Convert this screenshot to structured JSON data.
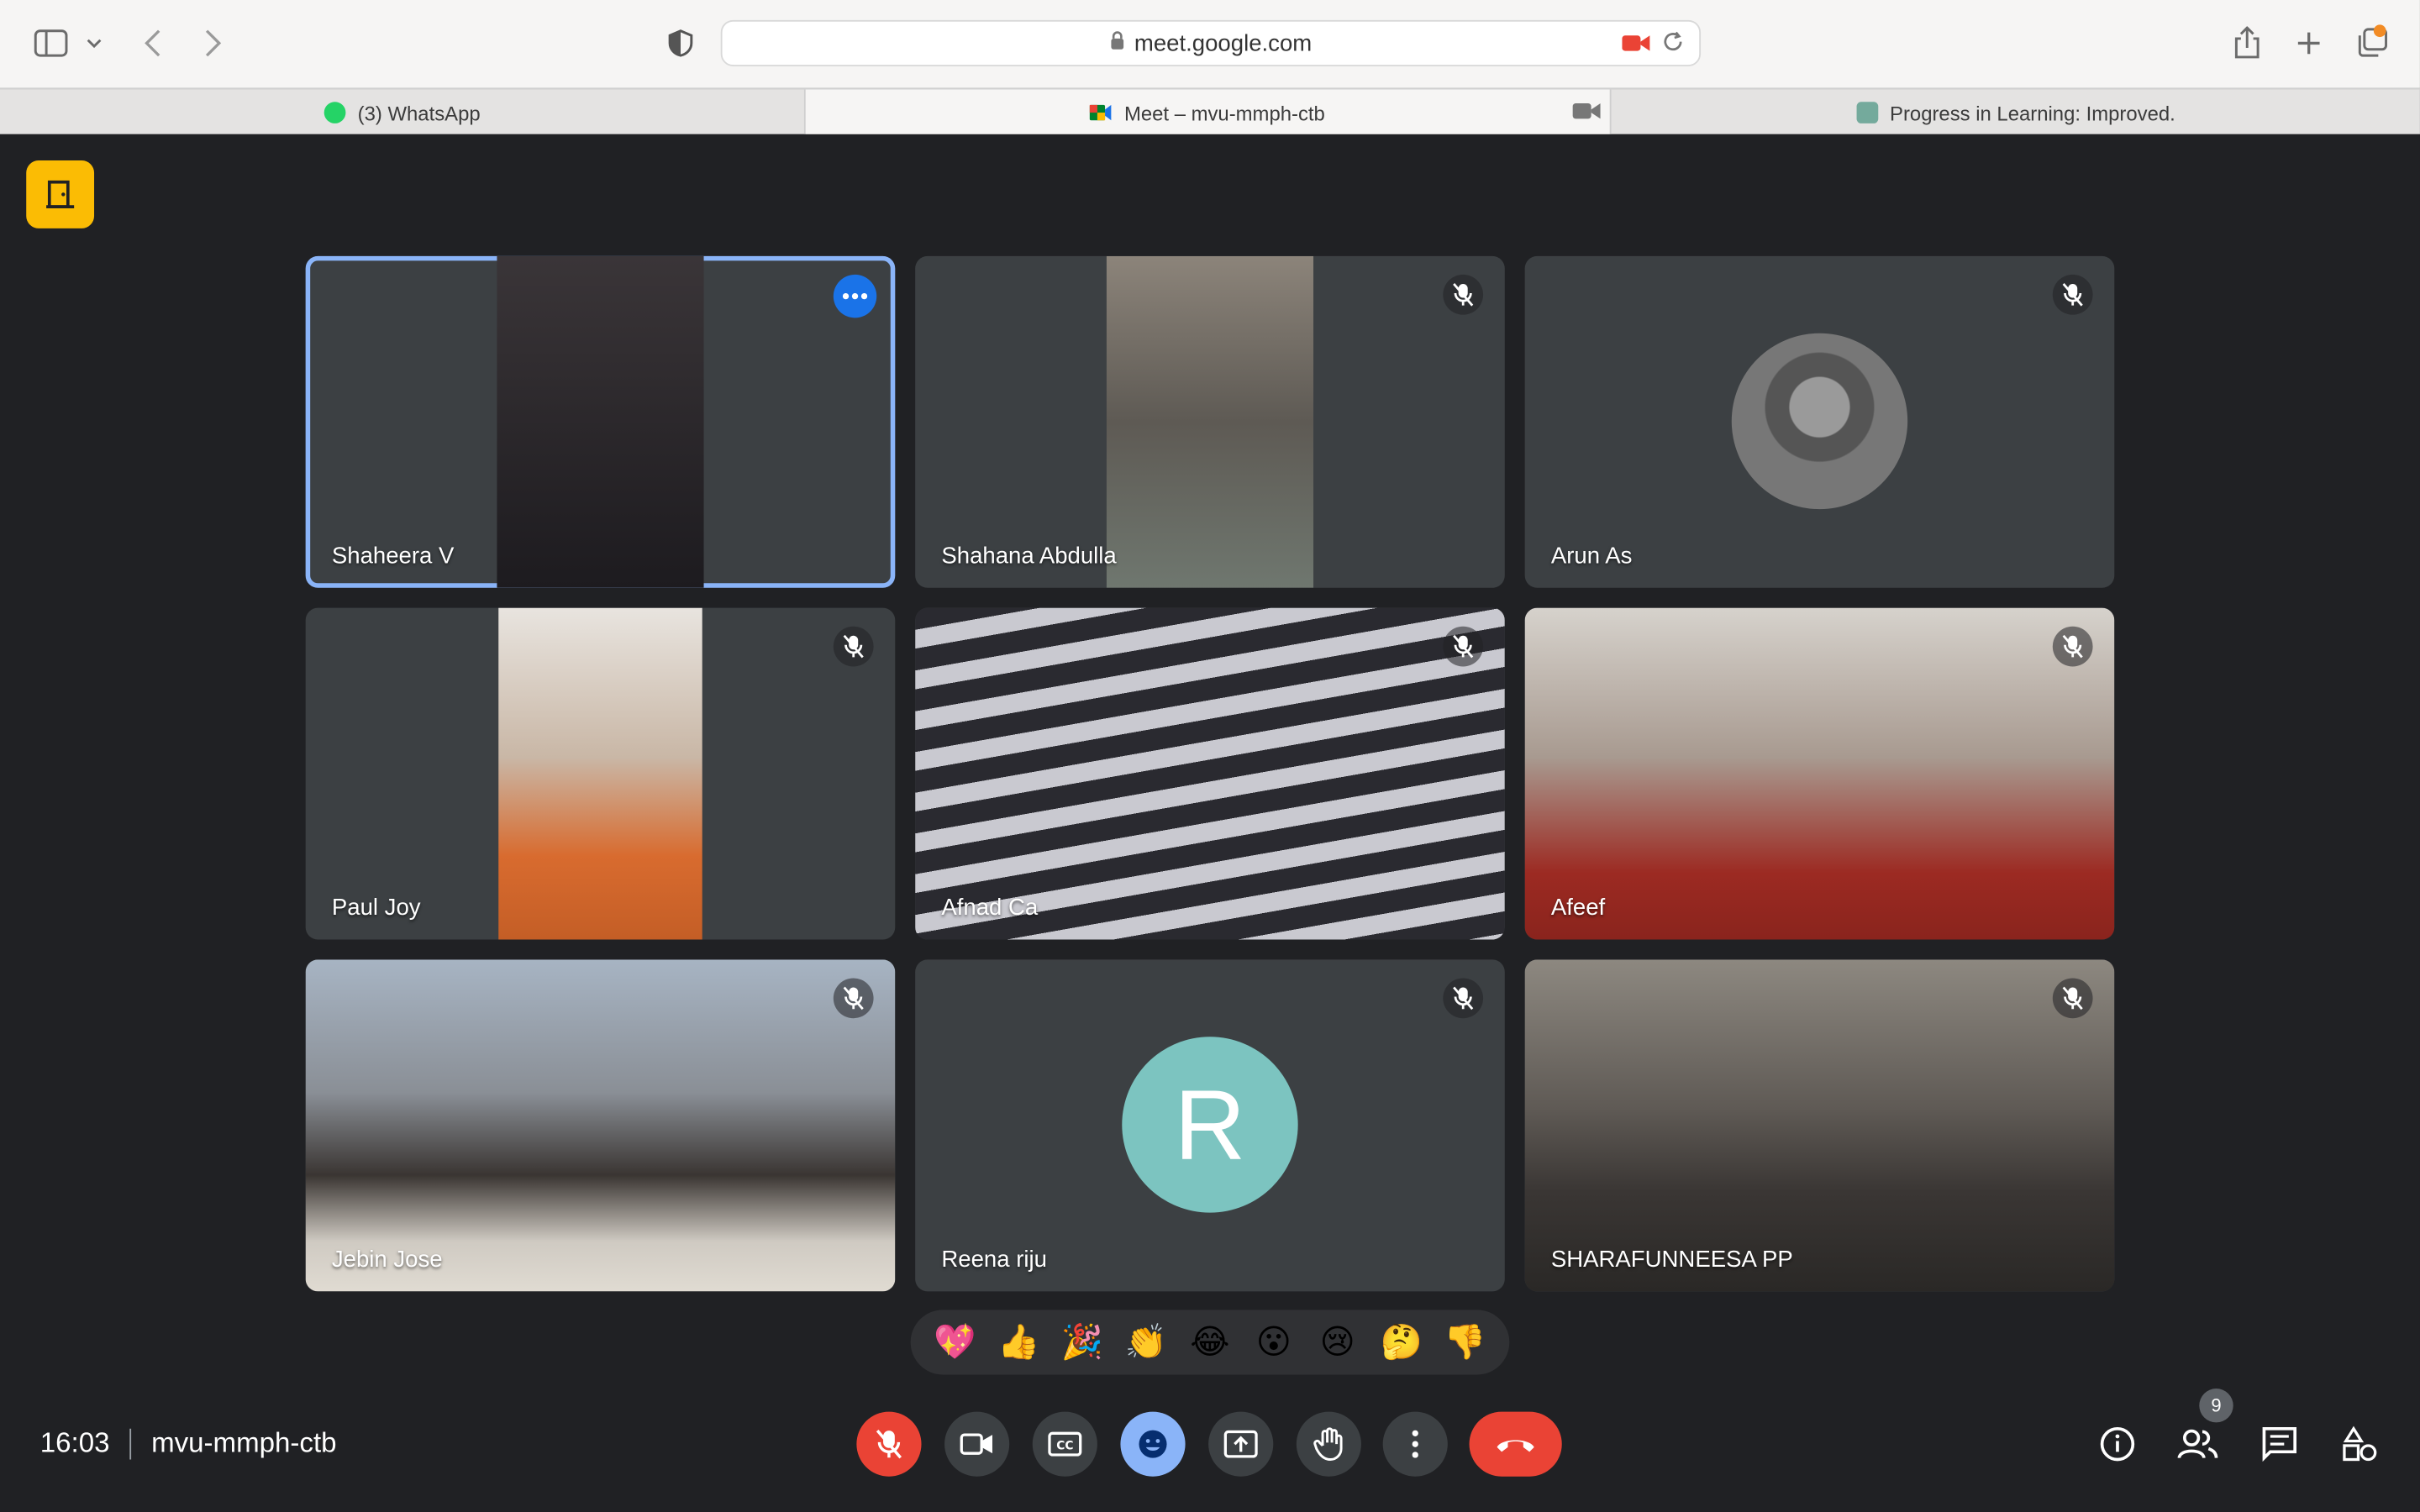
{
  "browser": {
    "url": "meet.google.com",
    "tabs": [
      {
        "label": "(3) WhatsApp",
        "icon": "whatsapp-icon",
        "color": "#25d366"
      },
      {
        "label": "Meet – mvu-mmph-ctb",
        "icon": "google-meet-icon",
        "color": "#00832d"
      },
      {
        "label": "Progress in Learning: Improved.",
        "icon": "chatgpt-icon",
        "color": "#74aa9c"
      }
    ]
  },
  "meeting": {
    "time": "16:03",
    "code": "mvu-mmph-ctb",
    "participant_count": "9"
  },
  "participants": [
    {
      "name": "Shaheera V",
      "bg": "#2b2830"
    },
    {
      "name": "Shahana Abdulla",
      "bg": "#6b6660"
    },
    {
      "name": "Arun As"
    },
    {
      "name": "Paul Joy",
      "bg": "#b9a89a"
    },
    {
      "name": "Afnad Ca",
      "bg": "#7b6a63"
    },
    {
      "name": "Afeef",
      "bg": "#8a7b72"
    },
    {
      "name": "Jebin Jose",
      "bg": "#7d8794"
    },
    {
      "name": "Reena riju",
      "initial": "R"
    },
    {
      "name": "SHARAFUNNEESA PP",
      "bg": "#6d6760"
    }
  ],
  "reactions": [
    "💖",
    "👍",
    "🎉",
    "👏",
    "😂",
    "😮",
    "😢",
    "🤔",
    "👎"
  ]
}
